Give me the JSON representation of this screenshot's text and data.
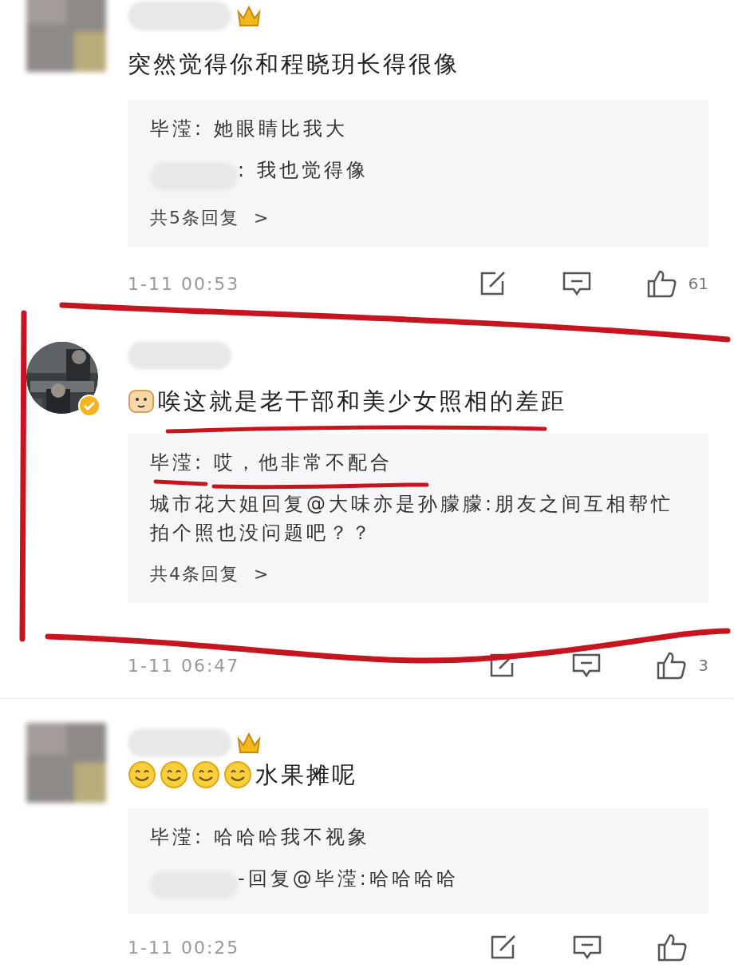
{
  "comments": [
    {
      "avatar": {
        "kind": "blurred"
      },
      "name_blurred": true,
      "badge": {
        "kind": "crown"
      },
      "text": "突然觉得你和程晓玥长得很像",
      "replies": [
        {
          "text": "毕滢: 她眼睛比我大"
        },
        {
          "name_blurred": true,
          "text": ": 我也觉得像"
        }
      ],
      "more": "共5条回复  >",
      "time": "1-11 00:53",
      "likes": "61"
    },
    {
      "avatar": {
        "kind": "picture"
      },
      "name_blurred": true,
      "badge": {
        "kind": "verified"
      },
      "emojis": [
        {
          "kind": "doge"
        }
      ],
      "text": "唉这就是老干部和美少女照相的差距",
      "replies": [
        {
          "text": "毕滢: 哎，他非常不配合"
        },
        {
          "text": "城市花大姐回复@大味亦是孙朦朦:朋友之间互相帮忙拍个照也没问题吧？？"
        }
      ],
      "more": "共4条回复  >",
      "time": "1-11 06:47",
      "likes": "3"
    },
    {
      "avatar": {
        "kind": "blurred"
      },
      "name_blurred": true,
      "badge": {
        "kind": "crown"
      },
      "emojis": [
        {
          "kind": "smile"
        },
        {
          "kind": "smile"
        },
        {
          "kind": "smile"
        },
        {
          "kind": "smile"
        }
      ],
      "text": "水果摊呢",
      "replies": [
        {
          "text": "毕滢: 哈哈哈我不视象"
        },
        {
          "name_blurred": true,
          "text": "-回复@毕滢:哈哈哈哈"
        }
      ],
      "time": "1-11 00:25"
    }
  ]
}
